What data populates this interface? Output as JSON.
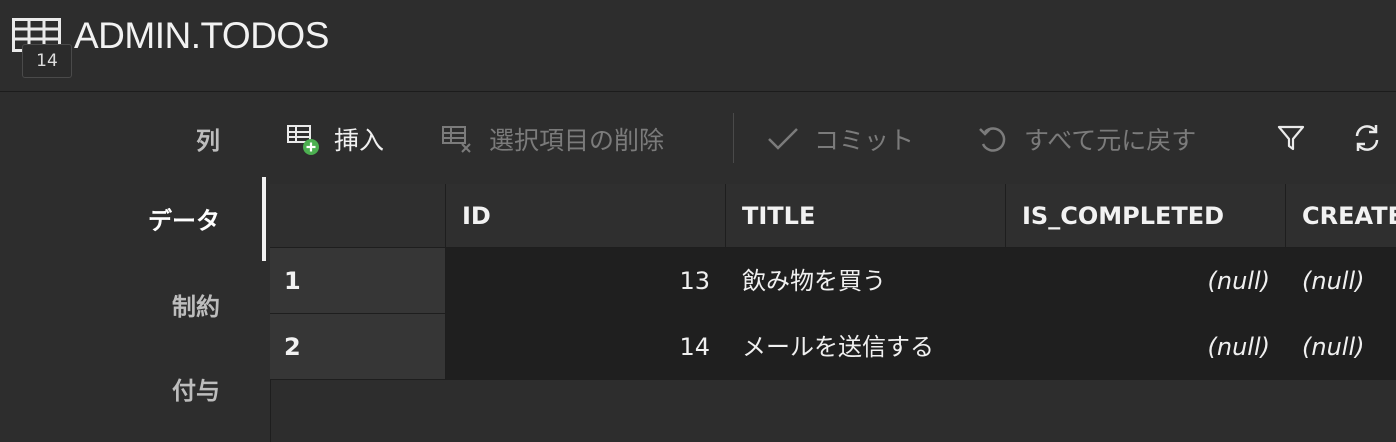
{
  "header": {
    "title": "ADMIN.TODOS",
    "tooltip": "14",
    "icon": "table-icon"
  },
  "sidebar": {
    "tabs": [
      {
        "label": "列",
        "active": false
      },
      {
        "label": "データ",
        "active": true
      },
      {
        "label": "制約",
        "active": false
      },
      {
        "label": "付与",
        "active": false
      }
    ]
  },
  "toolbar": {
    "insert_label": "挿入",
    "delete_label": "選択項目の削除",
    "commit_label": "コミット",
    "revert_label": "すべて元に戻す",
    "filter_icon": "filter-icon",
    "refresh_icon": "refresh-icon"
  },
  "grid": {
    "columns": [
      "ID",
      "TITLE",
      "IS_COMPLETED",
      "CREATE"
    ],
    "rows": [
      {
        "num": "1",
        "id": "13",
        "title": "飲み物を買う",
        "is_completed": "(null)",
        "created": "(null)"
      },
      {
        "num": "2",
        "id": "14",
        "title": "メールを送信する",
        "is_completed": "(null)",
        "created": "(null)"
      }
    ]
  },
  "colors": {
    "background": "#2d2d2d",
    "cell_background": "#1f1f1f",
    "insert_badge": "#4caf50"
  }
}
